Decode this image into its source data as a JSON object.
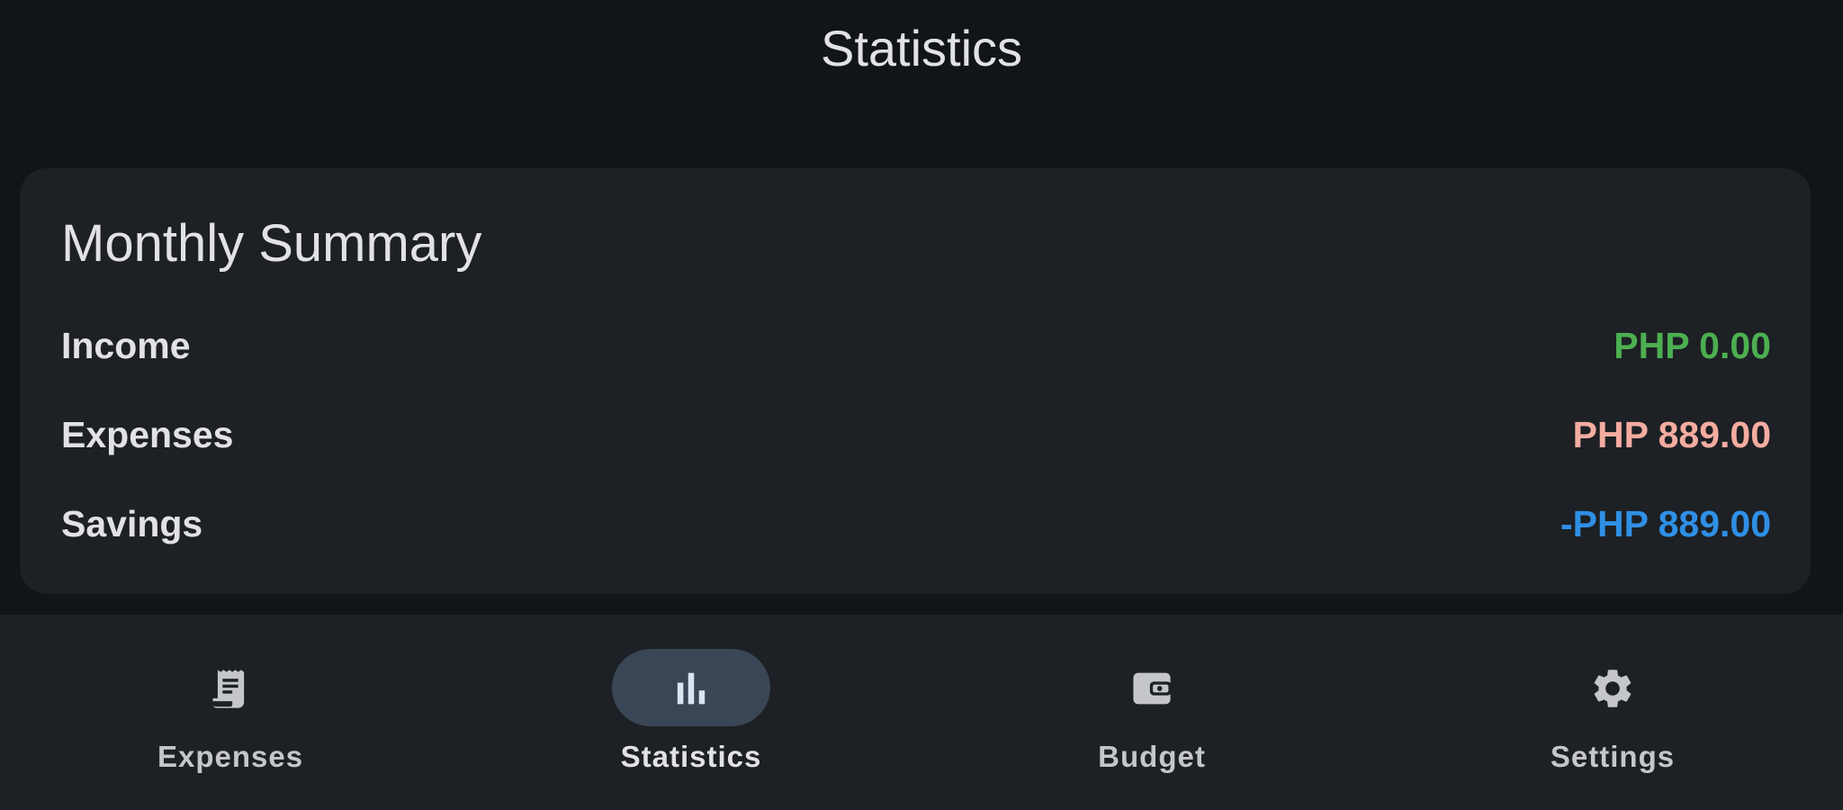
{
  "app_bar": {
    "title": "Statistics"
  },
  "summary": {
    "title": "Monthly Summary",
    "rows": [
      {
        "label": "Income",
        "value": "PHP 0.00",
        "color": "#4caf50"
      },
      {
        "label": "Expenses",
        "value": "PHP 889.00",
        "color": "#f4aca0"
      },
      {
        "label": "Savings",
        "value": "-PHP 889.00",
        "color": "#2f90e6"
      }
    ]
  },
  "nav": {
    "active": "Statistics",
    "items": [
      {
        "label": "Expenses",
        "icon": "receipt-icon"
      },
      {
        "label": "Statistics",
        "icon": "bar-chart-icon"
      },
      {
        "label": "Budget",
        "icon": "wallet-icon"
      },
      {
        "label": "Settings",
        "icon": "gear-icon"
      }
    ]
  },
  "colors": {
    "background": "#111418",
    "surface": "#1d2024",
    "active_pill": "#3a4655",
    "text_primary": "#e2e2e6",
    "text_secondary": "#c5c6cb"
  }
}
